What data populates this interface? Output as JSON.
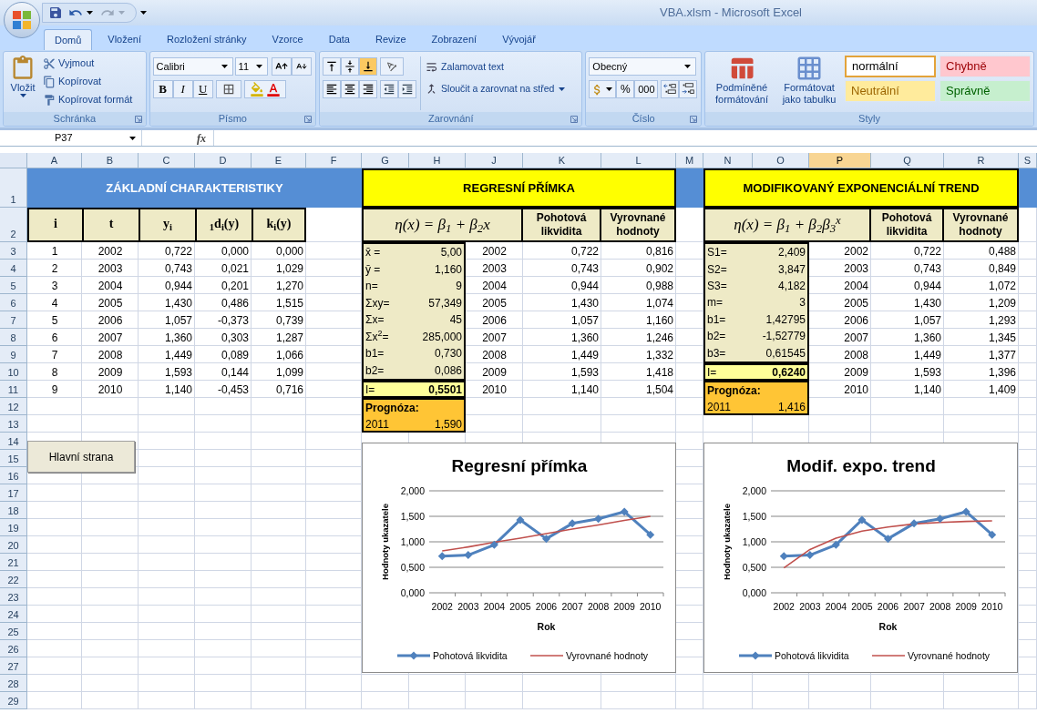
{
  "window": {
    "title": "VBA.xlsm - Microsoft Excel"
  },
  "ribbon_tabs": [
    {
      "label": "Domů",
      "selected": true
    },
    {
      "label": "Vložení",
      "selected": false
    },
    {
      "label": "Rozložení stránky",
      "selected": false
    },
    {
      "label": "Vzorce",
      "selected": false
    },
    {
      "label": "Data",
      "selected": false
    },
    {
      "label": "Revize",
      "selected": false
    },
    {
      "label": "Zobrazení",
      "selected": false
    },
    {
      "label": "Vývojář",
      "selected": false
    }
  ],
  "ribbon": {
    "clipboard": {
      "label": "Schránka",
      "paste": "Vložit",
      "actions": [
        "Vyjmout",
        "Kopírovat",
        "Kopírovat formát"
      ]
    },
    "font": {
      "label": "Písmo",
      "font_name": "Calibri",
      "font_size": "11",
      "styles": [
        "B",
        "I",
        "U"
      ]
    },
    "alignment": {
      "label": "Zarovnání",
      "vertical_alignment": [
        {
          "kind": "top",
          "selected": false
        },
        {
          "kind": "middle",
          "selected": false
        },
        {
          "kind": "bottom",
          "selected": true
        }
      ],
      "wrap_text": "Zalamovat text",
      "merge_center": "Sloučit a zarovnat na střed"
    },
    "number": {
      "label": "Číslo",
      "format": "Obecný",
      "percent": "%",
      "thousands": "000"
    },
    "styles": {
      "label": "Styly",
      "conditional_formatting": "Podmíněné formátování",
      "format_as_table": "Formátovat jako tabulku",
      "cell_styles": [
        {
          "label": "normální",
          "kind": "normal",
          "selected": true
        },
        {
          "label": "Chybně",
          "kind": "bad",
          "selected": false
        },
        {
          "label": "Neutrální",
          "kind": "neutral",
          "selected": false
        },
        {
          "label": "Správně",
          "kind": "good",
          "selected": false
        }
      ]
    }
  },
  "formula_bar": {
    "cell_reference": "P37",
    "function_label": "fx"
  },
  "sheet": {
    "columns": [
      {
        "label": "A",
        "selected": false
      },
      {
        "label": "B",
        "selected": false
      },
      {
        "label": "C",
        "selected": false
      },
      {
        "label": "D",
        "selected": false
      },
      {
        "label": "E",
        "selected": false
      },
      {
        "label": "F",
        "selected": false
      },
      {
        "label": "G",
        "selected": false
      },
      {
        "label": "H",
        "selected": false
      },
      {
        "label": "J",
        "selected": false
      },
      {
        "label": "K",
        "selected": false
      },
      {
        "label": "L",
        "selected": false
      },
      {
        "label": "M",
        "selected": false
      },
      {
        "label": "N",
        "selected": false
      },
      {
        "label": "O",
        "selected": false
      },
      {
        "label": "P",
        "selected": true
      },
      {
        "label": "Q",
        "selected": false
      },
      {
        "label": "R",
        "selected": false
      },
      {
        "label": "S",
        "selected": false
      }
    ],
    "rows": [
      "1",
      "2",
      "3",
      "4",
      "5",
      "6",
      "7",
      "8",
      "9",
      "10",
      "11",
      "12",
      "13",
      "14",
      "15",
      "16",
      "17",
      "18",
      "19",
      "20",
      "21",
      "22",
      "23",
      "24",
      "25",
      "26",
      "27",
      "28",
      "29"
    ]
  },
  "basic_stats": {
    "title": "ZÁKLADNÍ CHARAKTERISTIKY",
    "headers": [
      "i",
      "t",
      "y$_{i}$",
      "$_{1}$d$_{i}$(y)",
      "k$_{i}$(y)"
    ],
    "rows": [
      [
        "1",
        "2002",
        "0,722",
        "0,000",
        "0,000"
      ],
      [
        "2",
        "2003",
        "0,743",
        "0,021",
        "1,029"
      ],
      [
        "3",
        "2004",
        "0,944",
        "0,201",
        "1,270"
      ],
      [
        "4",
        "2005",
        "1,430",
        "0,486",
        "1,515"
      ],
      [
        "5",
        "2006",
        "1,057",
        "-0,373",
        "0,739"
      ],
      [
        "6",
        "2007",
        "1,360",
        "0,303",
        "1,287"
      ],
      [
        "7",
        "2008",
        "1,449",
        "0,089",
        "1,066"
      ],
      [
        "8",
        "2009",
        "1,593",
        "0,144",
        "1,099"
      ],
      [
        "9",
        "2010",
        "1,140",
        "-0,453",
        "0,716"
      ]
    ]
  },
  "regression": {
    "title": "REGRESNÍ PŘÍMKA",
    "formula": "η(x) =  β$_{1}$ + β$_{2}$x",
    "headers": [
      "Pohotová likvidita",
      "Vyrovnané hodnoty"
    ],
    "parameters": [
      {
        "label": "x̄ =",
        "value": "5,00"
      },
      {
        "label": "ȳ =",
        "value": "1,160"
      },
      {
        "label": "n=",
        "value": "9"
      },
      {
        "label": "Σxy=",
        "value": "57,349"
      },
      {
        "label": "Σx=",
        "value": "45"
      },
      {
        "label": "Σx$^{2}$=",
        "value": "285,000"
      },
      {
        "label": "b1=",
        "value": "0,730"
      },
      {
        "label": "b2=",
        "value": "0,086"
      }
    ],
    "index": {
      "label": "I=",
      "value": "0,5501"
    },
    "forecast": {
      "label": "Prognóza:",
      "year": "2011",
      "value": "1,590"
    },
    "rows": [
      [
        "2002",
        "0,722",
        "0,816"
      ],
      [
        "2003",
        "0,743",
        "0,902"
      ],
      [
        "2004",
        "0,944",
        "0,988"
      ],
      [
        "2005",
        "1,430",
        "1,074"
      ],
      [
        "2006",
        "1,057",
        "1,160"
      ],
      [
        "2007",
        "1,360",
        "1,246"
      ],
      [
        "2008",
        "1,449",
        "1,332"
      ],
      [
        "2009",
        "1,593",
        "1,418"
      ],
      [
        "2010",
        "1,140",
        "1,504"
      ]
    ]
  },
  "exp_trend": {
    "title": "MODIFIKOVANÝ EXPONENCIÁLNÍ TREND",
    "formula": "η(x) =  β$_{1}$ + β$_{2}$β$_{3}$$^{x}$",
    "headers": [
      "Pohotová likvidita",
      "Vyrovnané hodnoty"
    ],
    "parameters": [
      {
        "label": "S1=",
        "value": "2,409"
      },
      {
        "label": "S2=",
        "value": "3,847"
      },
      {
        "label": "S3=",
        "value": "4,182"
      },
      {
        "label": "m=",
        "value": "3"
      },
      {
        "label": "b1=",
        "value": "1,42795"
      },
      {
        "label": "b2=",
        "value": "-1,52779"
      },
      {
        "label": "b3=",
        "value": "0,61545"
      }
    ],
    "index": {
      "label": "I=",
      "value": "0,6240"
    },
    "forecast": {
      "label": "Prognóza:",
      "year": "2011",
      "value": "1,416"
    },
    "rows": [
      [
        "2002",
        "0,722",
        "0,488"
      ],
      [
        "2003",
        "0,743",
        "0,849"
      ],
      [
        "2004",
        "0,944",
        "1,072"
      ],
      [
        "2005",
        "1,430",
        "1,209"
      ],
      [
        "2006",
        "1,057",
        "1,293"
      ],
      [
        "2007",
        "1,360",
        "1,345"
      ],
      [
        "2008",
        "1,449",
        "1,377"
      ],
      [
        "2009",
        "1,593",
        "1,396"
      ],
      [
        "2010",
        "1,140",
        "1,409"
      ]
    ]
  },
  "button": {
    "label": "Hlavní strana"
  },
  "charts": [
    {
      "chart_data": {
        "type": "line",
        "title": "Regresní přímka",
        "xlabel": "Rok",
        "ylabel": "Hodnoty ukazatele",
        "categories": [
          "2002",
          "2003",
          "2004",
          "2005",
          "2006",
          "2007",
          "2008",
          "2009",
          "2010"
        ],
        "series": [
          {
            "name": "Pohotová likvidita",
            "color": "#4f81bd",
            "marker": "diamond",
            "values": [
              0.72,
              0.74,
              0.94,
              1.43,
              1.06,
              1.36,
              1.45,
              1.59,
              1.14
            ]
          },
          {
            "name": "Vyrovnané hodnoty",
            "color": "#c0504d",
            "values": [
              0.82,
              0.9,
              0.99,
              1.07,
              1.16,
              1.25,
              1.33,
              1.42,
              1.5
            ]
          }
        ],
        "grid": true,
        "legend": true,
        "ylim": [
          0,
          2
        ],
        "yticks": [
          {
            "value": 0,
            "label": "0,000"
          },
          {
            "value": 0.5,
            "label": "0,500"
          },
          {
            "value": 1,
            "label": "1,000"
          },
          {
            "value": 1.5,
            "label": "1,500"
          },
          {
            "value": 2,
            "label": "2,000"
          }
        ]
      }
    },
    {
      "chart_data": {
        "type": "line",
        "title": "Modif. expo. trend",
        "xlabel": "Rok",
        "ylabel": "Hodnoty ukazatele",
        "categories": [
          "2002",
          "2003",
          "2004",
          "2005",
          "2006",
          "2007",
          "2008",
          "2009",
          "2010"
        ],
        "series": [
          {
            "name": "Pohotová likvidita",
            "color": "#4f81bd",
            "marker": "diamond",
            "values": [
              0.72,
              0.74,
              0.94,
              1.43,
              1.06,
              1.36,
              1.45,
              1.59,
              1.14
            ]
          },
          {
            "name": "Vyrovnané hodnoty",
            "color": "#c0504d",
            "values": [
              0.49,
              0.85,
              1.07,
              1.21,
              1.29,
              1.35,
              1.38,
              1.4,
              1.41
            ]
          }
        ],
        "grid": true,
        "legend": true,
        "ylim": [
          0,
          2
        ],
        "yticks": [
          {
            "value": 0,
            "label": "0,000"
          },
          {
            "value": 0.5,
            "label": "0,500"
          },
          {
            "value": 1,
            "label": "1,000"
          },
          {
            "value": 1.5,
            "label": "1,500"
          },
          {
            "value": 2,
            "label": "2,000"
          }
        ]
      }
    }
  ]
}
